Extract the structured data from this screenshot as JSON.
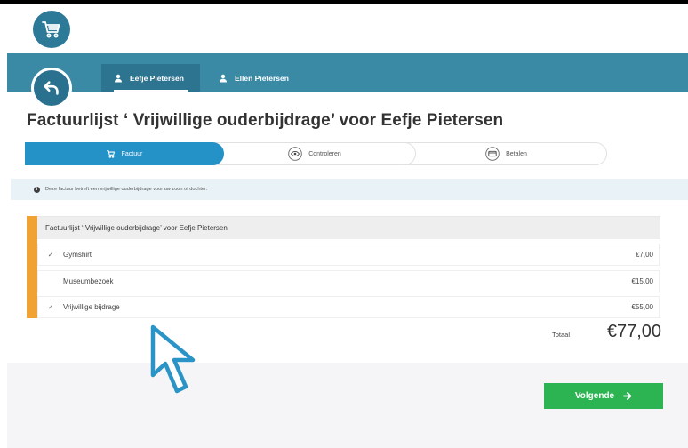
{
  "header": {
    "children_tabs": [
      {
        "label": "Eefje Pietersen",
        "active": true
      },
      {
        "label": "Ellen Pietersen",
        "active": false
      }
    ]
  },
  "page": {
    "title": "Factuurlijst ‘ Vrijwillige ouderbijdrage’ voor Eefje Pietersen"
  },
  "steps": [
    {
      "label": "Factuur",
      "icon": "cart-icon",
      "active": true
    },
    {
      "label": "Controleren",
      "icon": "eye-icon",
      "active": false
    },
    {
      "label": "Betalen",
      "icon": "card-icon",
      "active": false
    }
  ],
  "info": {
    "text": "Deze factuur betreft een vrijwillige ouderbijdrage voor uw zoon of dochter."
  },
  "invoice": {
    "header": "Factuurlijst ‘ Vrijwillige ouderbijdrage’ voor Eefje Pietersen",
    "items": [
      {
        "checked": true,
        "name": "Gymshirt",
        "price": "€7,00"
      },
      {
        "checked": false,
        "name": "Museumbezoek",
        "price": "€15,00"
      },
      {
        "checked": true,
        "name": "Vrijwillige bijdrage",
        "price": "€55,00"
      }
    ],
    "total_label": "Totaal",
    "total_value": "€77,00"
  },
  "actions": {
    "next_label": "Volgende"
  },
  "colors": {
    "primary_teal": "#3a8aa6",
    "step_active": "#2491c7",
    "accent_orange": "#f0a232",
    "next_green": "#2cb352",
    "cursor": "#2a94c7"
  }
}
